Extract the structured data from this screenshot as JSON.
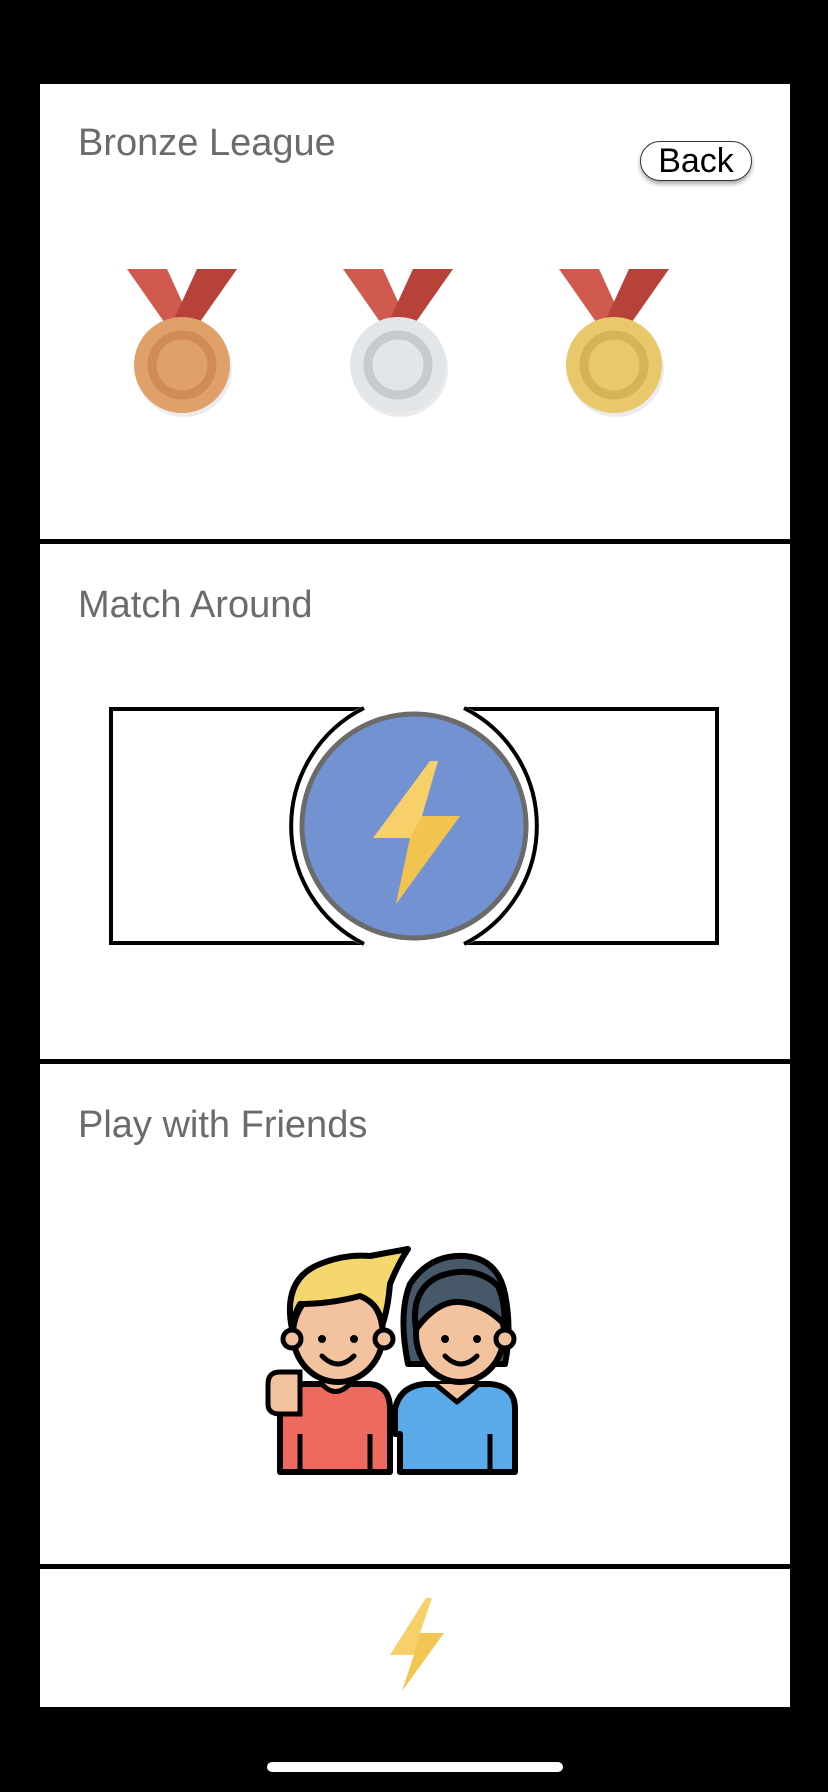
{
  "league": {
    "title": "Bronze League",
    "back_label": "Back",
    "medals": [
      {
        "name": "bronze",
        "color": "#E0A06A"
      },
      {
        "name": "silver",
        "color": "#E3E6E8"
      },
      {
        "name": "gold",
        "color": "#E8C86A"
      }
    ],
    "ribbon_color": "#C8483E"
  },
  "match": {
    "title": "Match Around",
    "button_icon": "lightning-bolt-icon",
    "button_color": "#7090D0"
  },
  "friends": {
    "title": "Play with Friends",
    "illustration": "two-friends-icon"
  },
  "tab_bar": {
    "icon": "lightning-bolt-icon",
    "icon_color": "#F7CF5E"
  },
  "colors": {
    "background": "#000000",
    "card": "#FFFFFF",
    "title_text": "#6B6B6B",
    "divider": "#000000"
  }
}
